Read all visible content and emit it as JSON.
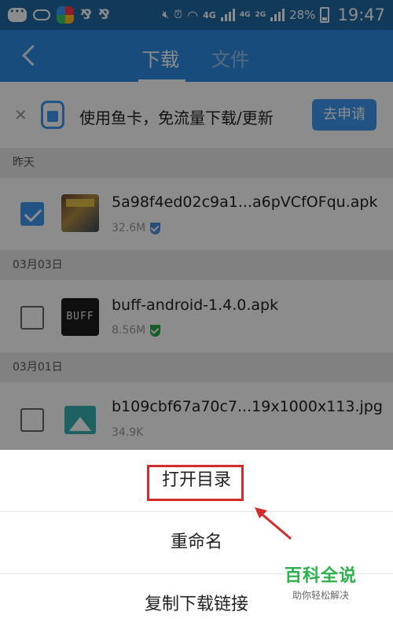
{
  "status_bar": {
    "net_4g": "4G",
    "net_4g_small": "4G",
    "net_2g_small": "2G",
    "battery": "28%",
    "time": "19:47",
    "icons": [
      "chat-icon",
      "cloud-icon",
      "app-store-icon",
      "app-glyph-icon",
      "app-glyph-icon",
      "mute-icon",
      "alarm-icon",
      "wifi-icon",
      "signal-icon",
      "battery-icon"
    ]
  },
  "header": {
    "tabs": [
      {
        "label": "下载",
        "active": true
      },
      {
        "label": "文件",
        "active": false
      }
    ]
  },
  "promo": {
    "text": "使用鱼卡，免流量下载/更新",
    "button": "去申请"
  },
  "groups": [
    {
      "date": "昨天",
      "items": [
        {
          "name": "5a98f4ed02c9a1...a6pVCfOFqu.apk",
          "size": "32.6M",
          "checked": true,
          "thumb": "game-icon",
          "badge": "shield-blue"
        }
      ]
    },
    {
      "date": "03月03日",
      "items": [
        {
          "name": "buff-android-1.4.0.apk",
          "size": "8.56M",
          "checked": false,
          "thumb": "BUFF",
          "badge": "shield-green"
        }
      ]
    },
    {
      "date": "03月01日",
      "items": [
        {
          "name": "b109cbf67a70c7...19x1000x113.jpg",
          "size": "34.9K",
          "checked": false,
          "thumb": "image-icon",
          "badge": "none"
        }
      ]
    }
  ],
  "sheet": {
    "items": [
      "打开目录",
      "重命名",
      "复制下载链接"
    ]
  },
  "watermark": {
    "title": "百科全说",
    "subtitle": "助你轻松解决"
  },
  "colors": {
    "status_bar": "#1f6aa5",
    "header": "#2d8be2",
    "accent": "#3d98f0",
    "highlight": "#d32a2a",
    "watermark": "#2bb24c"
  }
}
